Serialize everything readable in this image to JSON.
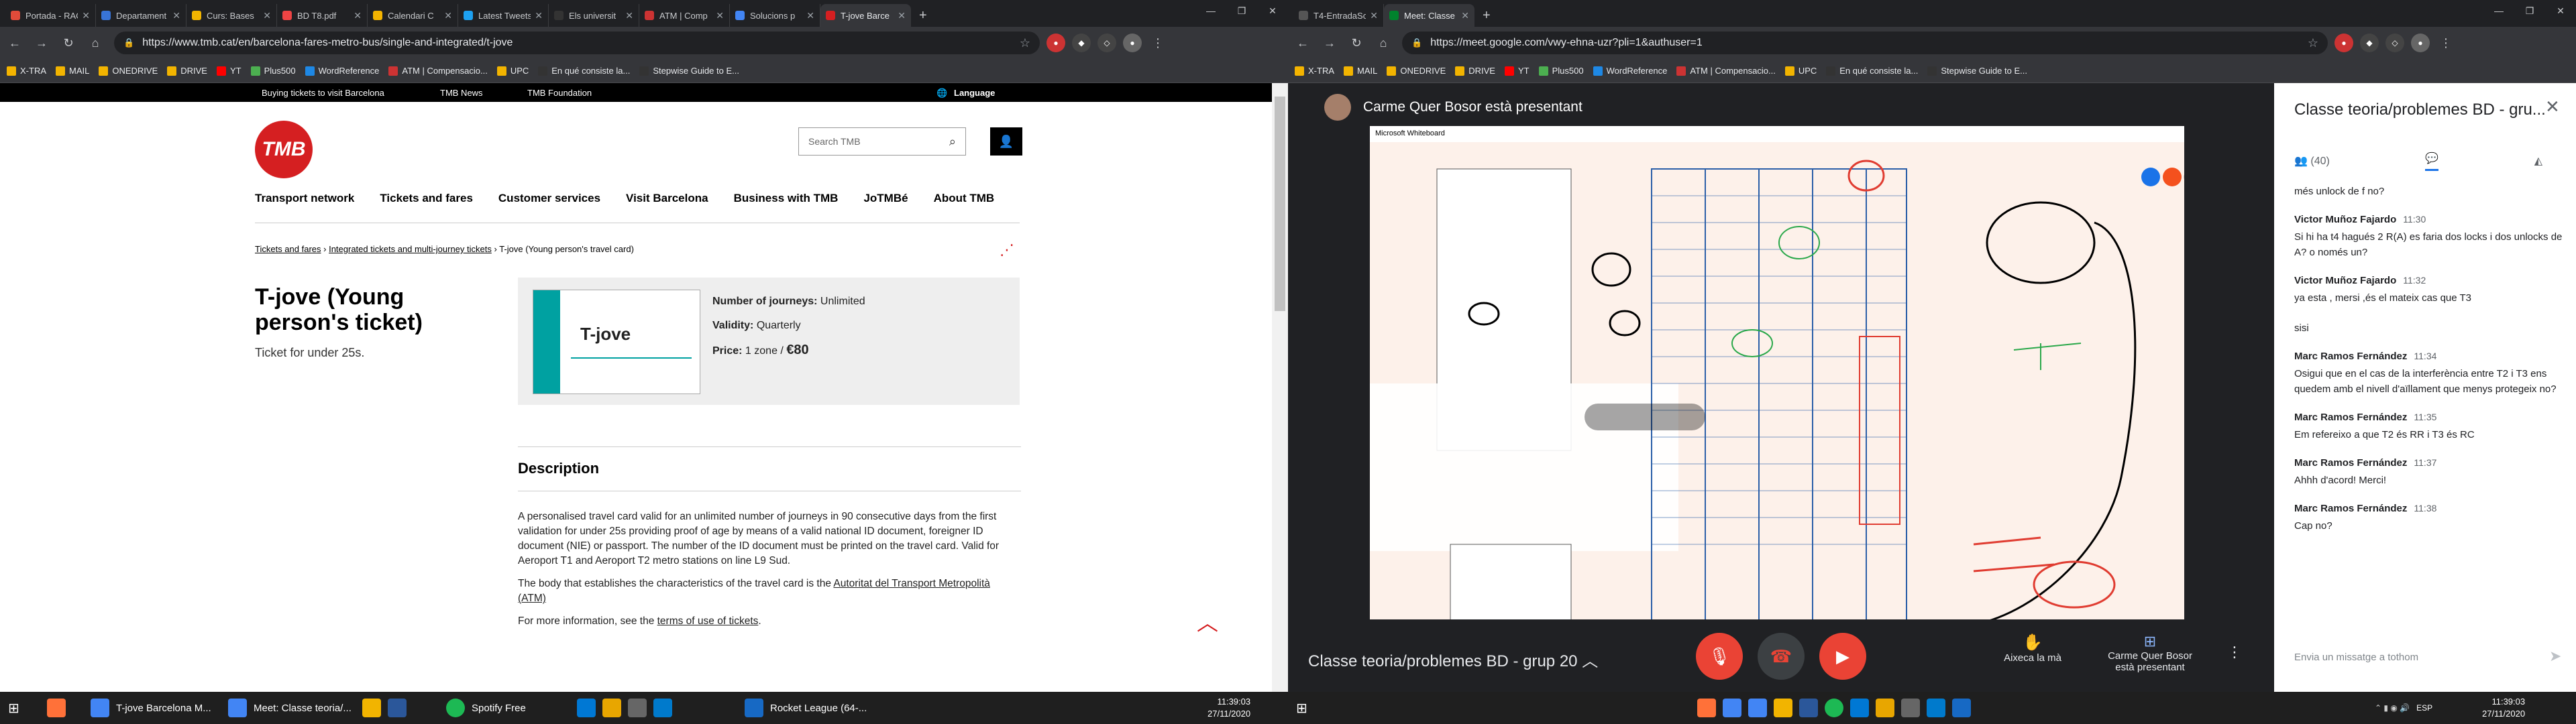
{
  "left_browser": {
    "tabs": [
      {
        "label": "Portada - RAC1",
        "color": "#e04b3a"
      },
      {
        "label": "Departament",
        "color": "#3874d8"
      },
      {
        "label": "Curs: Bases",
        "color": "#f2b400"
      },
      {
        "label": "BD T8.pdf",
        "color": "#e44"
      },
      {
        "label": "Calendari C",
        "color": "#f4b400"
      },
      {
        "label": "Latest Tweets",
        "color": "#1da1f2"
      },
      {
        "label": "Els universit",
        "color": "#333"
      },
      {
        "label": "ATM | Comp",
        "color": "#c33"
      },
      {
        "label": "Solucions p",
        "color": "#4285f4"
      },
      {
        "label": "T-jove Barce",
        "color": "#d51f21"
      }
    ],
    "url": "https://www.tmb.cat/en/barcelona-fares-metro-bus/single-and-integrated/t-jove",
    "bookmarks": [
      "X-TRA",
      "MAIL",
      "ONEDRIVE",
      "DRIVE",
      "YT",
      "Plus500",
      "WordReference",
      "ATM | Compensacio...",
      "UPC",
      "En qué consiste la...",
      "Stepwise Guide to E..."
    ]
  },
  "tmb": {
    "topbar": {
      "visit": "Buying tickets to visit Barcelona",
      "news": "TMB News",
      "foundation": "TMB Foundation",
      "language": "Language"
    },
    "logo": "TMB",
    "search_placeholder": "Search TMB",
    "nav": [
      "Transport network",
      "Tickets and fares",
      "Customer services",
      "Visit Barcelona",
      "Business with TMB",
      "JoTMBé",
      "About TMB"
    ],
    "breadcrumb": {
      "c1": "Tickets and fares",
      "c2": "Integrated tickets and multi-journey tickets",
      "c3": "T-jove (Young person's travel card)"
    },
    "title": "T-jove (Young person's ticket)",
    "subtitle": "Ticket for under 25s.",
    "card": {
      "image_label": "T-jove",
      "journeys_label": "Number of journeys:",
      "journeys_value": "Unlimited",
      "validity_label": "Validity:",
      "validity_value": "Quarterly",
      "price_label": "Price:",
      "price_zone": "1 zone /",
      "price_value": "€80"
    },
    "description_heading": "Description",
    "description_p1": "A personalised travel card valid for an unlimited number of journeys in 90 consecutive days from the first validation for under 25s providing proof of age by means of a valid national ID document, foreigner ID document (NIE) or passport. The number of the ID document must be printed on the travel card. Valid for Aeroport T1 and Aeroport T2 metro stations on line L9 Sud.",
    "description_p2_start": "The body that establishes the characteristics of the travel card is the",
    "description_p2_link": "Autoritat del Transport Metropolità (ATM)",
    "description_p3_start": "For more information, see the",
    "description_p3_link": "terms of use of tickets"
  },
  "right_browser": {
    "tabs": [
      {
        "label": "T4-EntradaSortida",
        "color": "#555"
      },
      {
        "label": "Meet: Classe teoria/problem",
        "color": "#00832d"
      }
    ],
    "url": "https://meet.google.com/vwy-ehna-uzr?pli=1&authuser=1",
    "bookmarks": [
      "X-TRA",
      "MAIL",
      "ONEDRIVE",
      "DRIVE",
      "YT",
      "Plus500",
      "WordReference",
      "ATM | Compensacio...",
      "UPC",
      "En qué consiste la...",
      "Stepwise Guide to E..."
    ]
  },
  "meet": {
    "presenter": "Carme Quer Bosor està presentant",
    "whiteboard_title": "Microsoft Whiteboard",
    "meeting_title": "Classe teoria/problemes BD - grup 20",
    "raise_hand": "Aixeca la mà",
    "now_presenting": "Carme Quer Bosor està presentant",
    "panel_title": "Classe teoria/problemes BD - gru...",
    "participants": "(40)",
    "send_placeholder": "Envia un missatge a tothom",
    "messages": [
      {
        "author": "",
        "time": "",
        "text": "més unlock de f no?"
      },
      {
        "author": "Victor Muñoz Fajardo",
        "time": "11:30",
        "text": "Si hi ha t4 hagués 2 R(A) es faria dos locks i dos unlocks de A? o només un?"
      },
      {
        "author": "Victor Muñoz Fajardo",
        "time": "11:32",
        "text": "ya esta , mersi ,és el mateix cas que T3"
      },
      {
        "author": "",
        "time": "",
        "text": "sisi"
      },
      {
        "author": "Marc Ramos Fernández",
        "time": "11:34",
        "text": "Osigui que en el cas de la interferència entre T2 i T3 ens quedem amb el nivell d'aïllament que menys protegeix no?"
      },
      {
        "author": "Marc Ramos Fernández",
        "time": "11:35",
        "text": "Em refereixo a que T2 és RR i T3 és RC"
      },
      {
        "author": "Marc Ramos Fernández",
        "time": "11:37",
        "text": "Ahhh d'acord! Merci!"
      },
      {
        "author": "Marc Ramos Fernández",
        "time": "11:38",
        "text": "Cap no?"
      }
    ]
  },
  "taskbar": {
    "left_items": [
      "T-jove Barcelona M...",
      "Meet: Classe teoria/...",
      "Spotify Free",
      "Rocket League (64-..."
    ],
    "time": "11:39:03",
    "date": "27/11/2020",
    "lang": "ESP"
  }
}
